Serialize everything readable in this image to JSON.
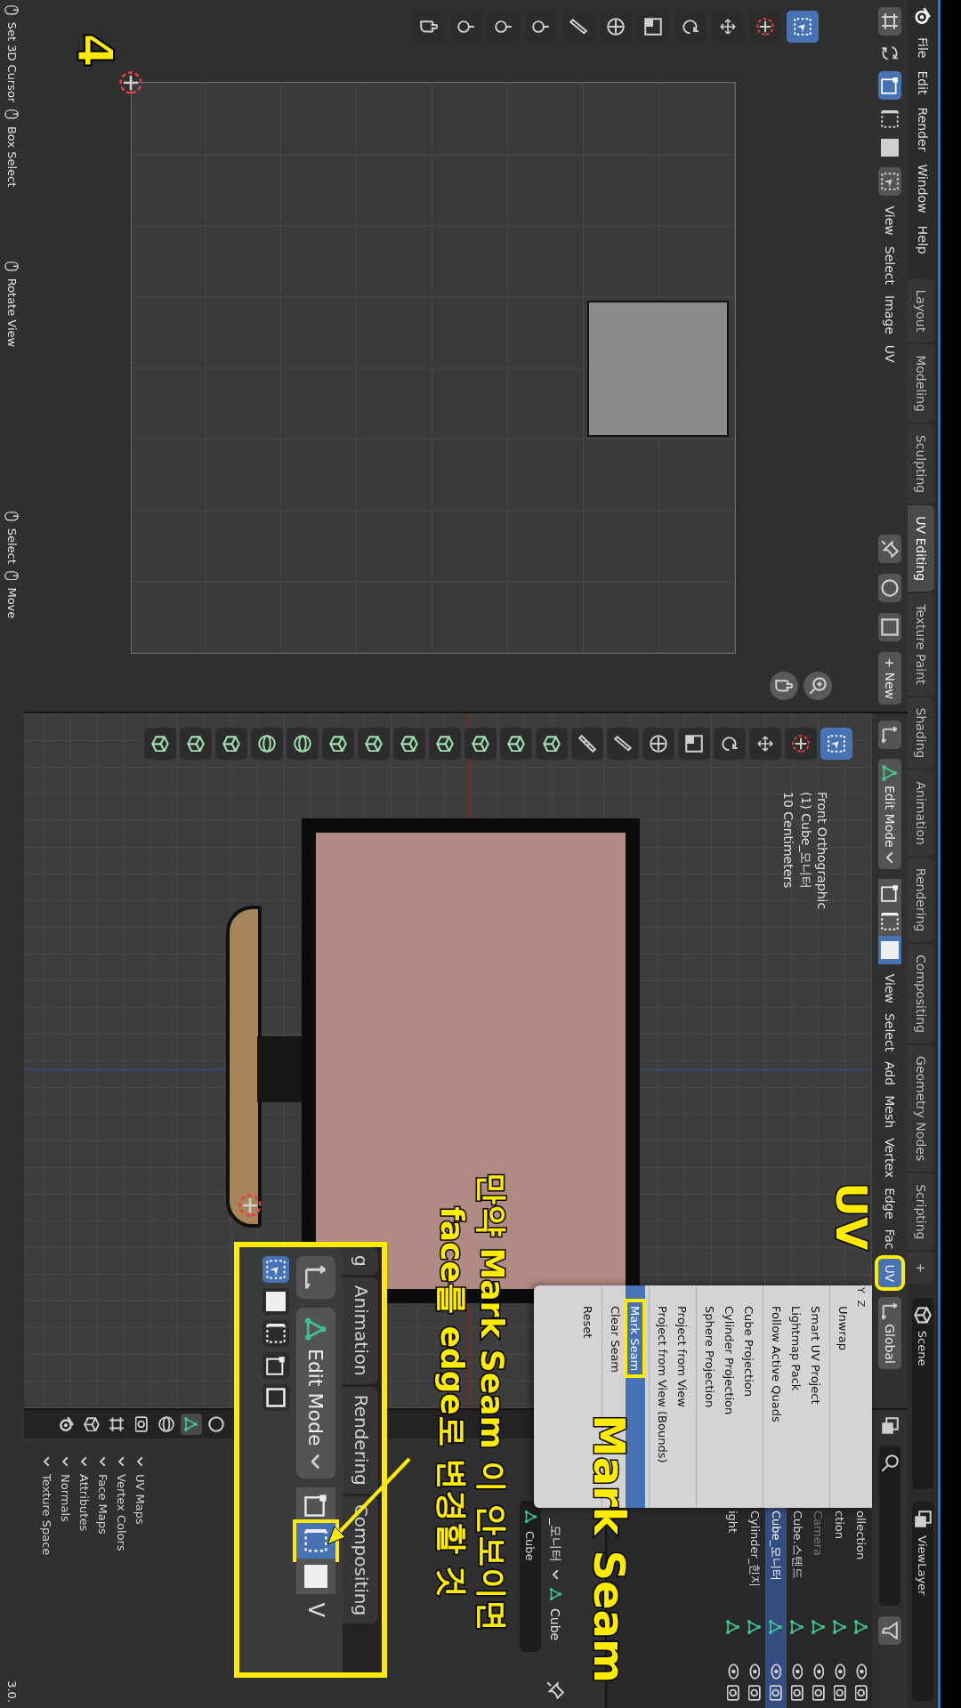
{
  "topbar": {
    "menus": [
      "File",
      "Edit",
      "Render",
      "Window",
      "Help"
    ],
    "tabs": [
      {
        "label": "Layout",
        "selected": false
      },
      {
        "label": "Modeling",
        "selected": false
      },
      {
        "label": "Sculpting",
        "selected": false
      },
      {
        "label": "UV Editing",
        "selected": true
      },
      {
        "label": "Texture Paint",
        "selected": false
      },
      {
        "label": "Shading",
        "selected": false
      },
      {
        "label": "Animation",
        "selected": false
      },
      {
        "label": "Rendering",
        "selected": false
      },
      {
        "label": "Compositing",
        "selected": false
      },
      {
        "label": "Geometry Nodes",
        "selected": false
      },
      {
        "label": "Scripting",
        "selected": false
      }
    ],
    "add_tab": "+",
    "scene": "Scene",
    "view_layer": "ViewLayer"
  },
  "uv_editor": {
    "menus": [
      "View",
      "Select",
      "Image",
      "UV"
    ],
    "new_button": "+ New"
  },
  "viewport": {
    "mode": "Edit Mode",
    "element_modes": [
      {
        "selected": false
      },
      {
        "selected": false
      },
      {
        "selected": true
      }
    ],
    "menus": [
      "View",
      "Select",
      "Add",
      "Mesh",
      "Vertex",
      "Edge",
      "Fac"
    ],
    "uv_button": {
      "label": "UV",
      "open": true
    },
    "orientation": "Global",
    "overlay_text": [
      "Front Orthographic",
      "(1) Cube_모니터",
      "10 Centimeters"
    ],
    "axis_labels": [
      "Y",
      "Z"
    ]
  },
  "uv_menu": {
    "groups": [
      [
        {
          "label": "Unwrap",
          "selected": false
        }
      ],
      [
        {
          "label": "Smart UV Project",
          "selected": false
        },
        {
          "label": "Lightmap Pack",
          "selected": false
        },
        {
          "label": "Follow Active Quads",
          "selected": false
        }
      ],
      [
        {
          "label": "Cube Projection",
          "selected": false
        },
        {
          "label": "Cylinder Projection",
          "selected": false
        },
        {
          "label": "Sphere Projection",
          "selected": false
        }
      ],
      [
        {
          "label": "Project from View",
          "selected": false
        },
        {
          "label": "Project from View (Bounds)",
          "selected": false
        }
      ],
      [
        {
          "label": "Mark Seam",
          "selected": true
        },
        {
          "label": "Clear Seam",
          "selected": false
        }
      ],
      [
        {
          "label": "Reset",
          "selected": false
        }
      ]
    ]
  },
  "outliner": {
    "rows": [
      {
        "label": "ollection",
        "selected": false,
        "dimmed": false
      },
      {
        "label": "ction",
        "selected": false,
        "dimmed": false
      },
      {
        "label": "Camera",
        "selected": false,
        "dimmed": true
      },
      {
        "label": "Cube.스텐드",
        "selected": false,
        "dimmed": false
      },
      {
        "label": "Cube_모니터",
        "selected": true,
        "dimmed": false
      },
      {
        "label": "Cylinder_힌지",
        "selected": false,
        "dimmed": false
      },
      {
        "label": "ight",
        "selected": false,
        "dimmed": false
      }
    ]
  },
  "properties": {
    "tabs": [
      {
        "selected": false
      },
      {
        "selected": true
      },
      {
        "selected": false
      },
      {
        "selected": false
      },
      {
        "selected": false
      },
      {
        "selected": false
      },
      {
        "selected": false
      }
    ],
    "object": "Cube",
    "breadcrumb": [
      "_모니터",
      "Cube"
    ],
    "panels": [
      "UV Maps",
      "Vertex Colors",
      "Face Maps",
      "Attributes",
      "Normals",
      "Texture Space"
    ]
  },
  "inset": {
    "tabs": [
      "g",
      "Animation",
      "Rendering",
      "Compositing"
    ],
    "mode": "Edit Mode",
    "element_modes": [
      {
        "selected": false
      },
      {
        "selected": true
      },
      {
        "selected": false
      }
    ],
    "view": "V"
  },
  "annotations": {
    "step": "4",
    "uv_label": "UV",
    "mark_seam_label": "Mark Seam",
    "note": [
      "만약 Mark Seam 이 안보이면",
      "face를 edge로 변경할 것"
    ]
  },
  "status_bar": {
    "hints": [
      "Set 3D Cursor",
      "Box Select",
      "Rotate View",
      "Select",
      "Move"
    ],
    "version": "3.0."
  }
}
